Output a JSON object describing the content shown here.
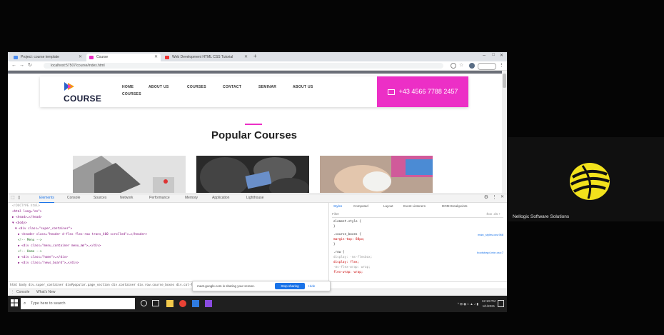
{
  "browser": {
    "tabs": [
      {
        "label": "Project: course template"
      },
      {
        "label": "Course"
      },
      {
        "label": "Web Development HTML CSS Tutorial"
      }
    ],
    "url": "localhost:57507/course/index.html"
  },
  "site": {
    "logo_text": "COURSE",
    "nav": [
      {
        "label": "HOME"
      },
      {
        "label": "ABOUT US"
      },
      {
        "label": "COURSES"
      },
      {
        "label": "CONTACT"
      },
      {
        "label": "SEMINAR"
      },
      {
        "label": "ABOUT US"
      },
      {
        "label": "COURSES"
      }
    ],
    "phone": "+43 4566 7788 2457",
    "section_title": "Popular Courses"
  },
  "devtools": {
    "tabs": [
      {
        "label": "Elements"
      },
      {
        "label": "Console"
      },
      {
        "label": "Sources"
      },
      {
        "label": "Network"
      },
      {
        "label": "Performance"
      },
      {
        "label": "Memory"
      },
      {
        "label": "Application"
      },
      {
        "label": "Lighthouse"
      }
    ],
    "code_lines": [
      "<!DOCTYPE html>",
      "<html lang=\"en\">",
      "▶ <head>…</head>",
      "▼ <body>",
      "  ▼ <div class=\"super_container\">",
      "    ▶ <header class=\"header d-flex flex-row trans_400 scrolled\">…</header>",
      "      <!-- Menu -->",
      "    ▶ <div class=\"menu_container menu_mm\">…</div>",
      "      <!-- Home -->",
      "    ▶ <div class=\"home\">…</div>",
      "    ▶ <div class=\"news_board\">…</div>"
    ],
    "style_tabs": [
      {
        "label": "Styles"
      },
      {
        "label": "Computed"
      },
      {
        "label": "Layout"
      },
      {
        "label": "Event Listeners"
      },
      {
        "label": "DOM Breakpoints"
      }
    ],
    "filter_placeholder": "Filter",
    "filter_extra": ":hov .cls +",
    "style_rules": [
      {
        "text": "element.style {",
        "link": ""
      },
      {
        "text": "}",
        "link": ""
      },
      {
        "text": ".course_boxes {",
        "link": "main_styles.css:968"
      },
      {
        "text": "  margin-top: 88px;",
        "link": ""
      },
      {
        "text": "}",
        "link": ""
      },
      {
        "text": ".row {",
        "link": "bootstrap4.min.css:7"
      },
      {
        "text": "  display: -ms-flexbox;",
        "link": ""
      },
      {
        "text": "  display: flex;",
        "link": ""
      },
      {
        "text": "  -ms-flex-wrap: wrap;",
        "link": ""
      },
      {
        "text": "  flex-wrap: wrap;",
        "link": ""
      }
    ],
    "breadcrumb": "html  body  div.super_container  div#popular.page_section  div.container  div.row.course_boxes  div.col-lg-4",
    "drawer_tabs": [
      {
        "label": "Console"
      },
      {
        "label": "What's New"
      }
    ],
    "share_banner": {
      "text": "meet.google.com is sharing your screen.",
      "stop": "Stop sharing",
      "hide": "Hide"
    }
  },
  "taskbar": {
    "search_placeholder": "Type here to search",
    "time": "12:10 PM",
    "date": "1/1/2021"
  },
  "participant": {
    "name": "Nellogic Software Solutions"
  },
  "colors": {
    "accent": "#ec2fc6",
    "chrome_tab_bg": "#dee1e6",
    "devtools_blue": "#1a73e8",
    "logo_yellow": "#f2e21c"
  }
}
